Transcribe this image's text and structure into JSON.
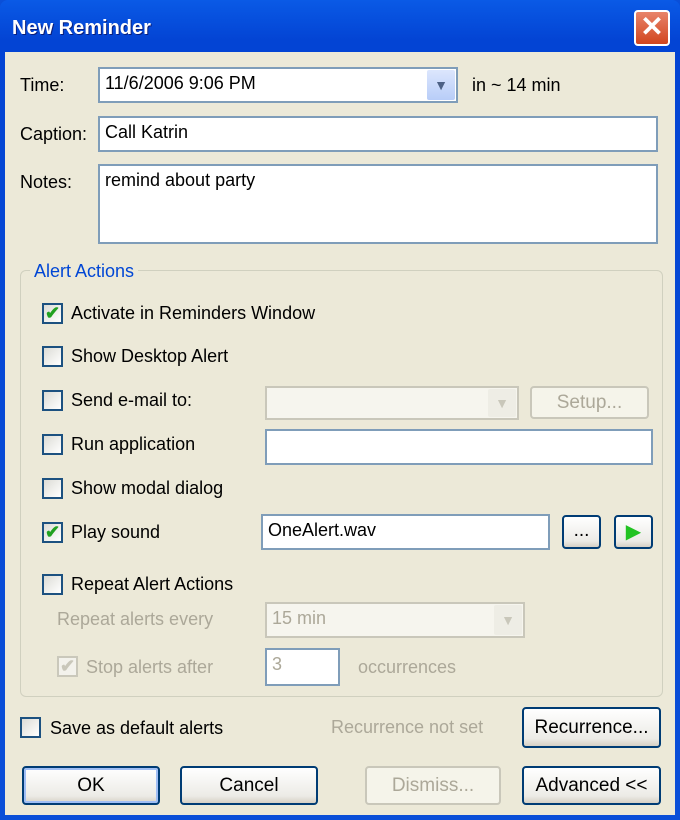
{
  "window": {
    "title": "New Reminder",
    "close_icon": "close-icon"
  },
  "time": {
    "label": "Time:",
    "value": "11/6/2006 9:06 PM",
    "relative": "in ~ 14 min"
  },
  "caption": {
    "label": "Caption:",
    "value": "Call Katrin"
  },
  "notes": {
    "label": "Notes:",
    "value": "remind about party"
  },
  "alert_actions": {
    "legend": "Alert Actions",
    "activate": {
      "label": "Activate in Reminders Window",
      "checked": true
    },
    "desktop": {
      "label": "Show Desktop Alert",
      "checked": false
    },
    "email": {
      "label": "Send e-mail to:",
      "checked": false,
      "value": "",
      "setup_label": "Setup..."
    },
    "run": {
      "label": "Run application",
      "checked": false,
      "value": ""
    },
    "modal": {
      "label": "Show modal dialog",
      "checked": false
    },
    "sound": {
      "label": "Play sound",
      "checked": true,
      "value": "OneAlert.wav",
      "browse_label": "...",
      "play_icon": "play-icon"
    },
    "repeat": {
      "label": "Repeat Alert Actions",
      "checked": false,
      "every_label": "Repeat alerts every",
      "every_value": "15 min",
      "stop_label": "Stop alerts after",
      "stop_checked": true,
      "stop_value": "3",
      "occurrences_label": "occurrences"
    }
  },
  "footer": {
    "save_default": "Save as default alerts",
    "recurrence_status": "Recurrence not set",
    "recurrence_label": "Recurrence...",
    "ok": "OK",
    "cancel": "Cancel",
    "dismiss": "Dismiss...",
    "advanced": "Advanced <<"
  },
  "colors": {
    "accent": "#0046d5",
    "check": "#21a121",
    "play": "#22c322"
  }
}
